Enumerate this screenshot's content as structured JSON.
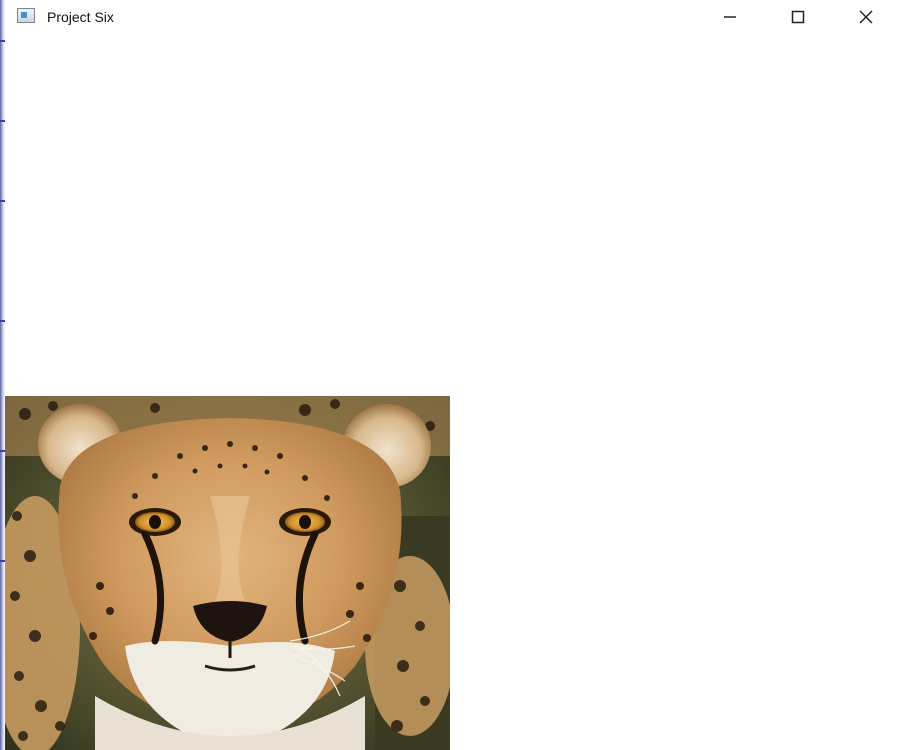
{
  "window": {
    "title": "Project Six",
    "controls": {
      "minimize_icon": "minimize-icon",
      "maximize_icon": "maximize-icon",
      "close_icon": "close-icon"
    }
  },
  "content": {
    "image_subject": "cheetah"
  },
  "colors": {
    "background": "#ffffff",
    "title_text": "#111111"
  }
}
